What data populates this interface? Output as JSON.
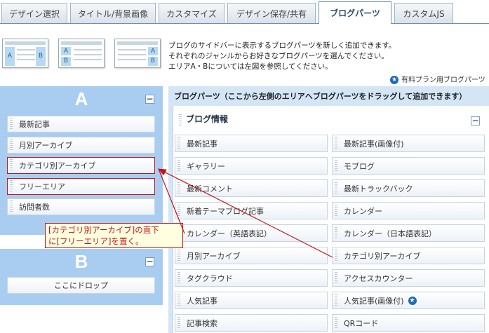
{
  "tabs": [
    "デザイン選択",
    "タイトル/背景画像",
    "カスタマイズ",
    "デザイン保存/共有",
    "ブログパーツ",
    "カスタムJS"
  ],
  "active_tab": "ブログパーツ",
  "layout_thumbs": [
    {
      "labels": [
        "A",
        "B"
      ]
    },
    {
      "labels": [
        "A",
        "B"
      ]
    },
    {
      "labels": [
        "A",
        "B"
      ]
    }
  ],
  "intro": {
    "line1": "ブログのサイドバーに表示するブログパーツを新しく追加できます。",
    "line2": "それぞれのジャンルからお好きなブログパーツを選んでください。",
    "line3": "エリアA・Bについては左図を参照してください。",
    "paid_note": "有料プラン用ブログパーツ"
  },
  "area_a": {
    "letter": "A",
    "items": [
      "最新記事",
      "月別アーカイブ",
      "カテゴリ別アーカイブ",
      "フリーエリア",
      "訪問者数"
    ]
  },
  "area_b": {
    "letter": "B",
    "drop_label": "ここにドロップ"
  },
  "annotation": {
    "line1": "[カテゴリ別アーカイブ]の直下",
    "line2": "に[フリーエリア]を置く。"
  },
  "parts_panel": {
    "title": "ブログパーツ（ここから左側のエリアへブログパーツをドラッグして追加できます）",
    "category_title": "ブログ情報",
    "left_column": [
      "最新記事",
      "ギャラリー",
      "最新コメント",
      "新着テーマブログ記事",
      "カレンダー（英語表記）",
      "月別アーカイブ",
      "タグクラウド",
      "人気記事",
      "記事検索"
    ],
    "right_column": [
      "最新記事(画像付)",
      "モブログ",
      "最新トラックバック",
      "カレンダー",
      "カレンダー（日本語表記）",
      "カテゴリ別アーカイブ",
      "アクセスカウンター",
      "人気記事(画像付)",
      "QRコード"
    ]
  },
  "colors": {
    "area_bg": "#a9cdf0",
    "panel_bg": "#d4e6f6",
    "highlight": "#c0141b",
    "paid_star": "#1e6bb0"
  }
}
